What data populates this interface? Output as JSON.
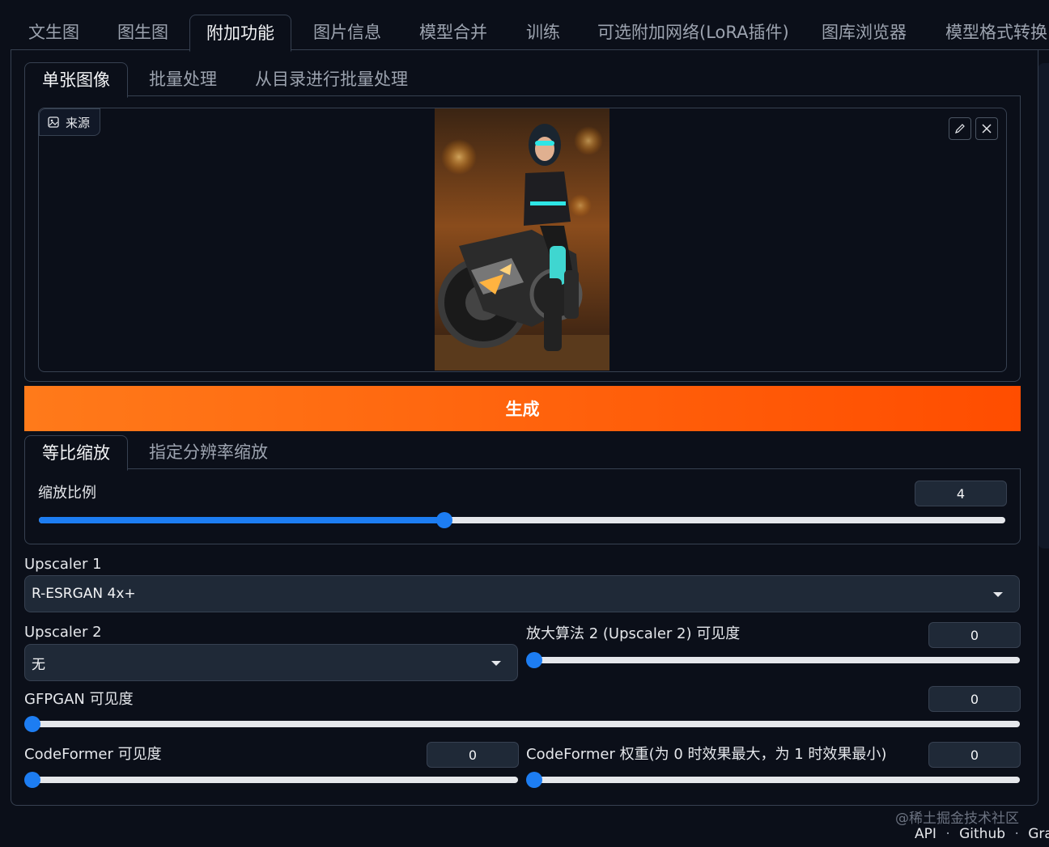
{
  "top_tabs": [
    "文生图",
    "图生图",
    "附加功能",
    "图片信息",
    "模型合并",
    "训练",
    "可选附加网络(LoRA插件)",
    "图库浏览器",
    "模型格式转换"
  ],
  "top_tabs_active_index": 2,
  "sub_tabs": [
    "单张图像",
    "批量处理",
    "从目录进行批量处理"
  ],
  "sub_tabs_active_index": 0,
  "source": {
    "label": "来源",
    "icon": "image-icon",
    "edit_icon": "pencil-icon",
    "clear_icon": "close-icon"
  },
  "generate_label": "生成",
  "scale_tabs": [
    "等比缩放",
    "指定分辨率缩放"
  ],
  "scale_tabs_active_index": 0,
  "resize": {
    "label": "缩放比例",
    "value": "4",
    "min": 1,
    "max": 8,
    "fraction": 0.42
  },
  "upscaler1": {
    "label": "Upscaler 1",
    "value": "R-ESRGAN 4x+"
  },
  "upscaler2": {
    "label": "Upscaler 2",
    "value": "无"
  },
  "upscaler2_visibility": {
    "label": "放大算法 2 (Upscaler 2) 可见度",
    "value": "0",
    "fraction": 0
  },
  "gfpgan_visibility": {
    "label": "GFPGAN 可见度",
    "value": "0",
    "fraction": 0
  },
  "codeformer_visibility": {
    "label": "CodeFormer 可见度",
    "value": "0",
    "fraction": 0
  },
  "codeformer_weight": {
    "label": "CodeFormer 权重(为 0 时效果最大，为 1 时效果最小)",
    "value": "0",
    "fraction": 0
  },
  "footer": {
    "watermark": "@稀土掘金技术社区",
    "links": [
      "API",
      "Github",
      "Gradio"
    ],
    "separator": "·"
  },
  "colors": {
    "accent": "#1d7df2",
    "generate_start": "#ff7a1a",
    "generate_end": "#ff4d00",
    "background": "#0b0f19"
  }
}
